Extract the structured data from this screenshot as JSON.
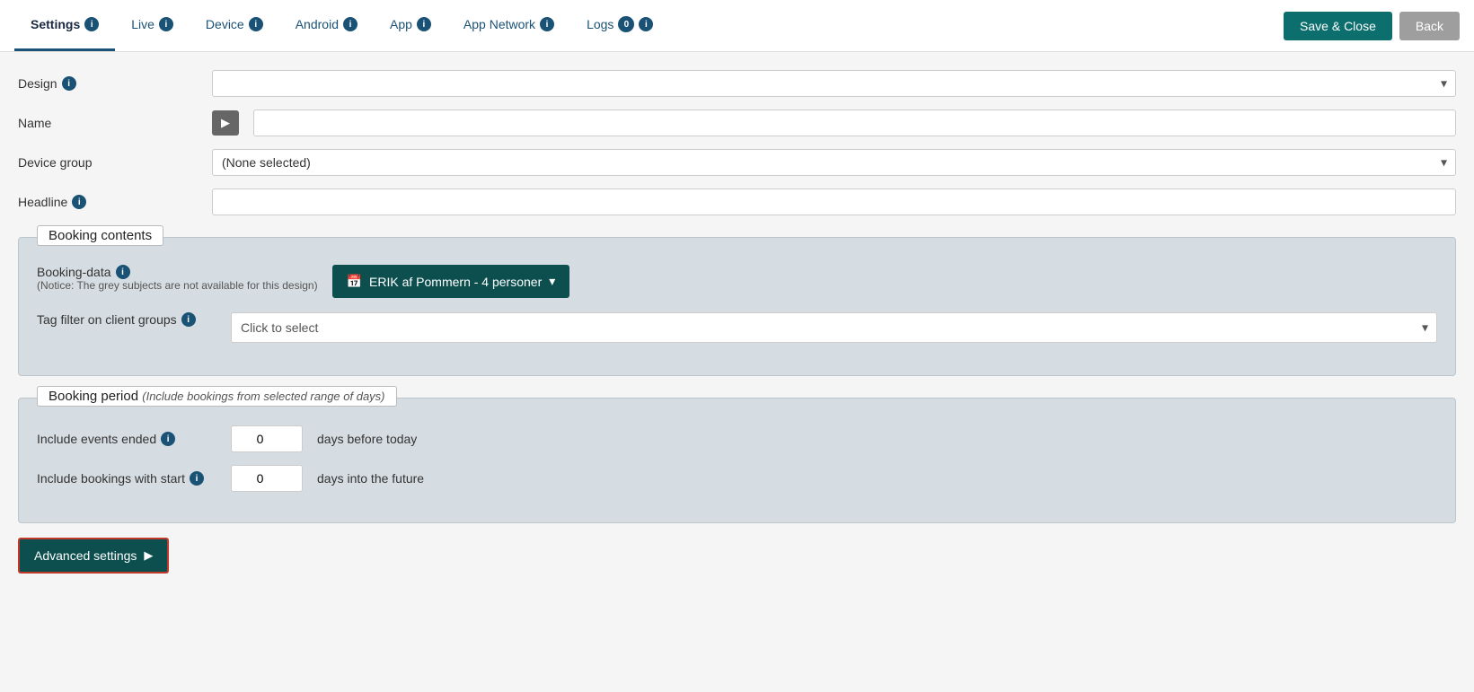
{
  "tabs": [
    {
      "id": "settings",
      "label": "Settings",
      "active": true,
      "info": true,
      "badge": null
    },
    {
      "id": "live",
      "label": "Live",
      "active": false,
      "info": true,
      "badge": null
    },
    {
      "id": "device",
      "label": "Device",
      "active": false,
      "info": true,
      "badge": null
    },
    {
      "id": "android",
      "label": "Android",
      "active": false,
      "info": true,
      "badge": null
    },
    {
      "id": "app",
      "label": "App",
      "active": false,
      "info": true,
      "badge": null
    },
    {
      "id": "app-network",
      "label": "App Network",
      "active": false,
      "info": true,
      "badge": null
    },
    {
      "id": "logs",
      "label": "Logs",
      "active": false,
      "info": true,
      "badge": "0"
    }
  ],
  "actions": {
    "save_close": "Save & Close",
    "back": "Back"
  },
  "form": {
    "design_label": "Design",
    "design_placeholder": "",
    "name_label": "Name",
    "name_icon": "▶",
    "device_group_label": "Device group",
    "device_group_value": "(None selected)",
    "headline_label": "Headline",
    "headline_placeholder": ""
  },
  "booking_contents": {
    "title": "Booking contents",
    "booking_data_label": "Booking-data",
    "booking_data_notice": "(Notice: The grey subjects are not available for this design)",
    "booking_data_value": "ERIK af Pommern - 4 personer",
    "booking_data_calendar_icon": "📅",
    "tag_filter_label": "Tag filter on client groups",
    "tag_filter_placeholder": "Click to select"
  },
  "booking_period": {
    "title": "Booking period",
    "title_italic": "(Include bookings from selected range of days)",
    "include_ended_label": "Include events ended",
    "include_ended_value": "0",
    "include_ended_suffix": "days before today",
    "include_start_label": "Include bookings with start",
    "include_start_value": "0",
    "include_start_suffix": "days into the future"
  },
  "advanced": {
    "label": "Advanced settings",
    "arrow": "▶"
  }
}
